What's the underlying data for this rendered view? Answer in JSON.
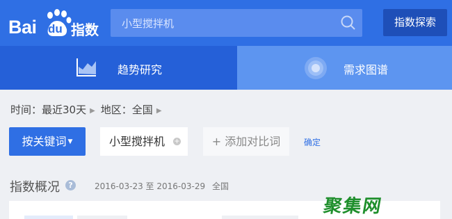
{
  "header": {
    "logo_text_en": "Bai",
    "logo_text_du": "du",
    "logo_text_cn": "指数",
    "search_value": "小型搅拌机",
    "explore_button": "指数探索"
  },
  "tabs": [
    {
      "label": "趋势研究",
      "active": true,
      "icon": "trend-chart-icon"
    },
    {
      "label": "需求图谱",
      "active": false,
      "icon": "demand-graph-icon"
    }
  ],
  "filters": {
    "time": "时间：最近30天",
    "region": "地区：全国"
  },
  "keywords": {
    "keyword_button": "按关键词",
    "chip": "小型搅拌机",
    "add_compare": "+ 添加对比词",
    "confirm": "确定"
  },
  "overview": {
    "title": "指数概况",
    "date_range": "2016-03-23 至 2016-03-29",
    "region": "全国"
  },
  "watermark": {
    "text": "聚集网"
  },
  "colors": {
    "brand_blue": "#2f6fe4",
    "tab_active": "#2560d8",
    "tab_bar": "#5d95f0"
  }
}
